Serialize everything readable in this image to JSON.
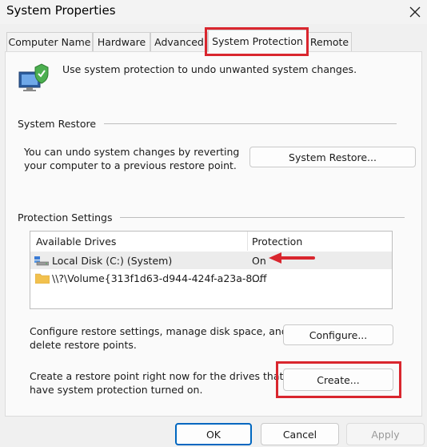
{
  "window": {
    "title": "System Properties"
  },
  "tabs": [
    {
      "label": "Computer Name"
    },
    {
      "label": "Hardware"
    },
    {
      "label": "Advanced"
    },
    {
      "label": "System Protection"
    },
    {
      "label": "Remote"
    }
  ],
  "intro": {
    "text": "Use system protection to undo unwanted system changes."
  },
  "system_restore": {
    "heading": "System Restore",
    "line1": "You can undo system changes by reverting",
    "line2": "your computer to a previous restore point.",
    "button": "System Restore..."
  },
  "protection": {
    "heading": "Protection Settings",
    "columns": {
      "drives": "Available Drives",
      "protection": "Protection"
    },
    "rows": [
      {
        "drive": "Local Disk (C:) (System)",
        "protection": "On"
      },
      {
        "drive": "\\\\?\\Volume{313f1d63-d944-424f-a23a-8...",
        "protection": "Off"
      }
    ],
    "configure_text1": "Configure restore settings, manage disk space, and",
    "configure_text2": "delete restore points.",
    "configure_button": "Configure...",
    "create_text1": "Create a restore point right now for the drives that",
    "create_text2": "have system protection turned on.",
    "create_button": "Create..."
  },
  "footer": {
    "ok": "OK",
    "cancel": "Cancel",
    "apply": "Apply"
  },
  "colors": {
    "highlight": "#d9262e",
    "accent_border": "#0067c0"
  }
}
